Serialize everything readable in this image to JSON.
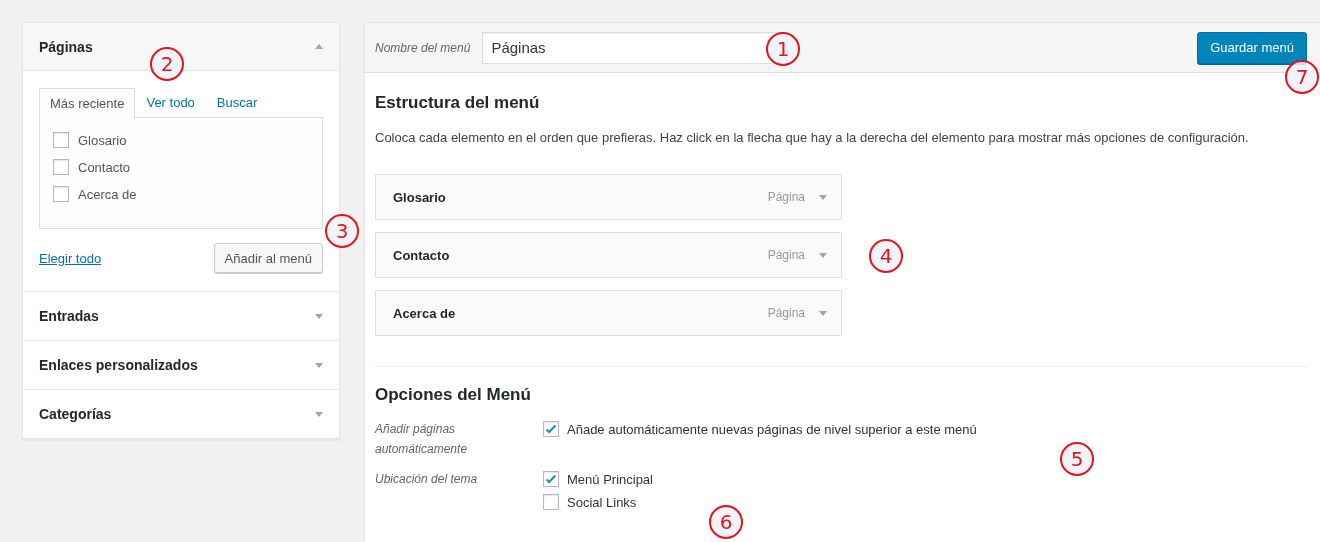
{
  "sidebar": {
    "sections": [
      {
        "title": "Páginas",
        "expanded": true,
        "tabs": [
          {
            "label": "Más reciente",
            "selected": true
          },
          {
            "label": "Ver todo",
            "selected": false
          },
          {
            "label": "Buscar",
            "selected": false
          }
        ],
        "items": [
          {
            "label": "Glosario",
            "checked": false
          },
          {
            "label": "Contacto",
            "checked": false
          },
          {
            "label": "Acerca de",
            "checked": false
          }
        ],
        "select_all": "Elegir todo",
        "add_button": "Añadir al menú"
      },
      {
        "title": "Entradas",
        "expanded": false
      },
      {
        "title": "Enlaces personalizados",
        "expanded": false
      },
      {
        "title": "Categorías",
        "expanded": false
      }
    ]
  },
  "menu_header": {
    "name_label": "Nombre del menú",
    "name_value": "Páginas",
    "save_button": "Guardar menú"
  },
  "structure": {
    "title": "Estructura del menú",
    "description": "Coloca cada elemento en el orden que prefieras. Haz click en la flecha que hay a la derecha del elemento para mostrar más opciones de configuración.",
    "items": [
      {
        "title": "Glosario",
        "type": "Página"
      },
      {
        "title": "Contacto",
        "type": "Página"
      },
      {
        "title": "Acerca de",
        "type": "Página"
      }
    ]
  },
  "options": {
    "title": "Opciones del Menú",
    "rows": [
      {
        "label": "Añadir páginas automáticamente",
        "choices": [
          {
            "label": "Añade automáticamente nuevas páginas de nivel superior a este menú",
            "checked": true
          }
        ]
      },
      {
        "label": "Ubicación del tema",
        "choices": [
          {
            "label": "Menú Principal",
            "checked": true
          },
          {
            "label": "Social Links",
            "checked": false
          }
        ]
      }
    ]
  },
  "callouts": [
    {
      "number": "1"
    },
    {
      "number": "2"
    },
    {
      "number": "3"
    },
    {
      "number": "4"
    },
    {
      "number": "5"
    },
    {
      "number": "6"
    },
    {
      "number": "7"
    }
  ]
}
